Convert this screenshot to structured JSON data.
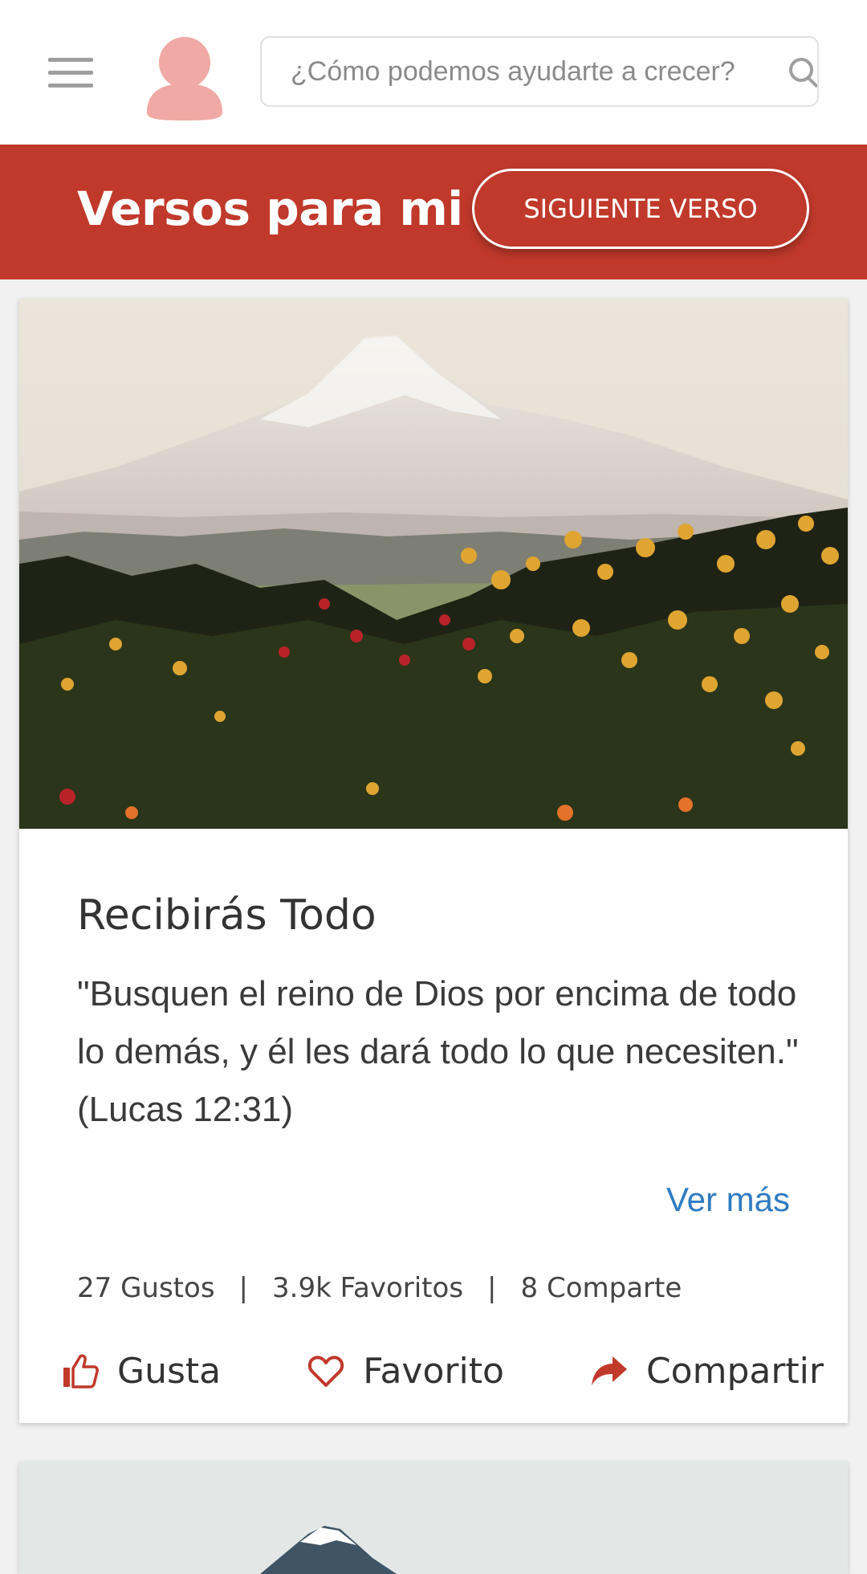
{
  "header": {
    "search_placeholder": "¿Cómo podemos ayudarte a crecer?"
  },
  "banner": {
    "title": "Versos para mi",
    "next_button": "SIGUIENTE VERSO",
    "color": "#c0392b"
  },
  "card": {
    "title": "Recibirás Todo",
    "verse": "\"Busquen el reino de Dios por encima de todo lo demás, y él les dará todo lo que necesiten.\" (Lucas 12:31)",
    "more_link": "Ver más",
    "stats": {
      "likes": "27 Gustos",
      "sep1": "|",
      "favorites": "3.9k Favoritos",
      "sep2": "|",
      "shares": "8 Comparte"
    },
    "actions": {
      "like": "Gusta",
      "favorite": "Favorito",
      "share": "Compartir"
    },
    "image": "mountain-flowers-landscape"
  },
  "colors": {
    "accent": "#c0392b",
    "link": "#2f7bc2"
  }
}
